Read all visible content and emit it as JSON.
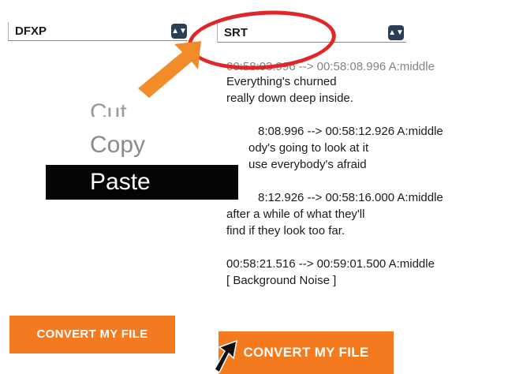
{
  "formats": {
    "left": {
      "value": "DFXP"
    },
    "right": {
      "value": "SRT"
    }
  },
  "subtitles": [
    {
      "time": "00:58:03.996 --> 00:58:08.996 A:middle",
      "lines": [
        "Everything's churned",
        "really down deep inside."
      ]
    },
    {
      "time": "8:08.996 --> 00:58:12.926 A:middle",
      "lines": [
        "ody's going to look at it",
        "use everybody's afraid"
      ]
    },
    {
      "time": "8:12.926 --> 00:58:16.000 A:middle",
      "lines": [
        "after a while of what they'll",
        "find if they look too far."
      ]
    },
    {
      "time": "00:58:21.516 --> 00:59:01.500 A:middle",
      "lines": [
        "[ Background Noise ]"
      ]
    }
  ],
  "context_menu": {
    "cut": "Cut",
    "copy": "Copy",
    "paste": "Paste"
  },
  "buttons": {
    "convert_left": "CONVERT MY FILE",
    "convert_right": "CONVERT MY FILE"
  },
  "colors": {
    "accent_orange": "#f47a20",
    "annotation_red": "#e02626",
    "select_arrow_bg": "#2c3e56"
  },
  "icons": {
    "select_arrow": "updown-chevron-icon",
    "annotation_arrow": "orange-arrow-icon",
    "cursor": "mouse-pointer-icon"
  }
}
